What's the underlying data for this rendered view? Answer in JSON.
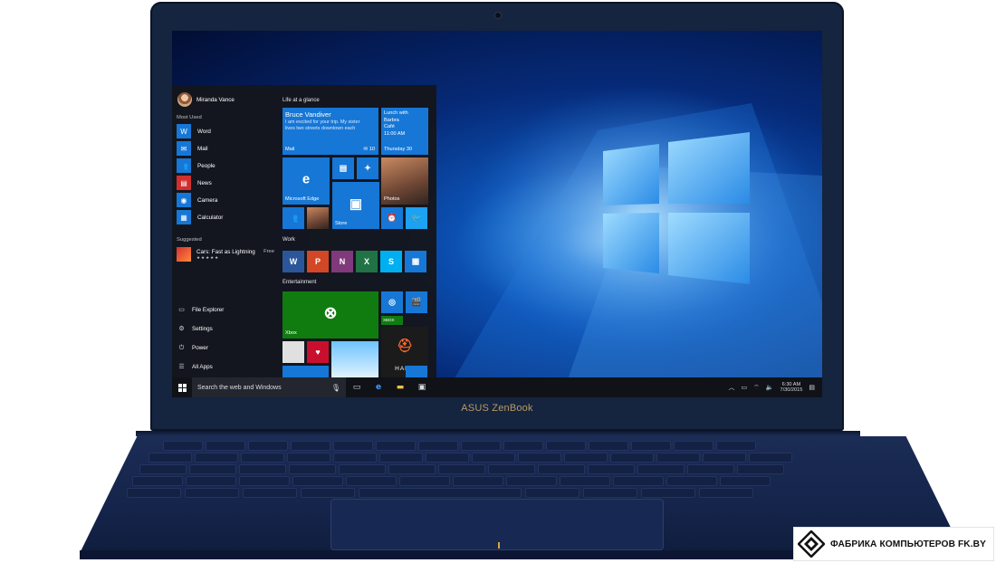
{
  "device": {
    "brand_label": "ASUS ZenBook"
  },
  "start_menu": {
    "user_name": "Miranda Vance",
    "most_used_label": "Most Used",
    "apps": [
      {
        "label": "Word",
        "icon": "word-icon"
      },
      {
        "label": "Mail",
        "icon": "mail-icon"
      },
      {
        "label": "People",
        "icon": "people-icon"
      },
      {
        "label": "News",
        "icon": "news-icon"
      },
      {
        "label": "Camera",
        "icon": "camera-icon"
      },
      {
        "label": "Calculator",
        "icon": "calculator-icon"
      }
    ],
    "suggested_label": "Suggested",
    "suggested_app": {
      "label": "Cars: Fast as Lightning",
      "rating": "★★★★★",
      "price": "Free"
    },
    "system_items": [
      {
        "label": "File Explorer",
        "icon": "folder-icon"
      },
      {
        "label": "Settings",
        "icon": "gear-icon"
      },
      {
        "label": "Power",
        "icon": "power-icon"
      },
      {
        "label": "All Apps",
        "icon": "all-apps-icon"
      }
    ],
    "groups": {
      "life": "Life at a glance",
      "work": "Work",
      "entertainment": "Entertainment"
    },
    "tiles": {
      "mail": {
        "sender": "Bruce Vandiver",
        "preview_line1": "I am excited for your trip. My sister",
        "preview_line2": "lives two streets downtown each",
        "label": "Mail",
        "count": "10"
      },
      "calendar": {
        "line1": "Lunch with",
        "line2": "Barbra",
        "line3": "Café",
        "line4": "11:00 AM",
        "day": "Thursday 30"
      },
      "edge": {
        "label": "Microsoft Edge"
      },
      "photos": {
        "label": "Photos"
      },
      "store": {
        "label": "Store"
      },
      "xbox": {
        "label": "Xbox"
      },
      "xbox_small": {
        "label": "XBOX"
      },
      "halo": {
        "label": "HALO"
      }
    }
  },
  "taskbar": {
    "search_placeholder": "Search the web and Windows",
    "time": "6:30 AM",
    "date": "7/30/2015"
  },
  "badge": {
    "text": "ФАБРИКА КОМПЬЮТЕРОВ FK.BY"
  },
  "colors": {
    "tile_blue": "#1677d6",
    "deck_navy": "#1b2c55",
    "brand_gold": "#b89b64"
  }
}
